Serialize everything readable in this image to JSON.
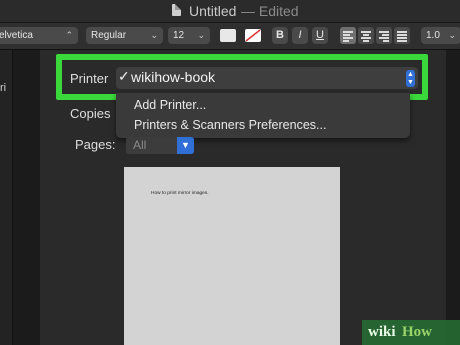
{
  "window": {
    "title": "Untitled",
    "title_suffix": "— Edited"
  },
  "toolbar": {
    "font_family": "elvetica",
    "font_style": "Regular",
    "font_size": "12",
    "bold": "B",
    "italic": "I",
    "underline": "U",
    "line_spacing": "1.0"
  },
  "sidebar": {
    "visible_text": "ri"
  },
  "print_dialog": {
    "printer_label": "Printer",
    "selected_check": "✓",
    "selected_printer": "wikihow-book",
    "copies_label": "Copies",
    "pages_label": "Pages:",
    "pages_value": "All",
    "menu_items": [
      "Add Printer...",
      "Printers & Scanners Preferences..."
    ],
    "preview_text": "How to print mirror images."
  },
  "watermark": {
    "wiki": "wiki",
    "how": "How"
  },
  "colors": {
    "highlight": "#3bd83b",
    "accent_blue": "#2f6fd6"
  }
}
